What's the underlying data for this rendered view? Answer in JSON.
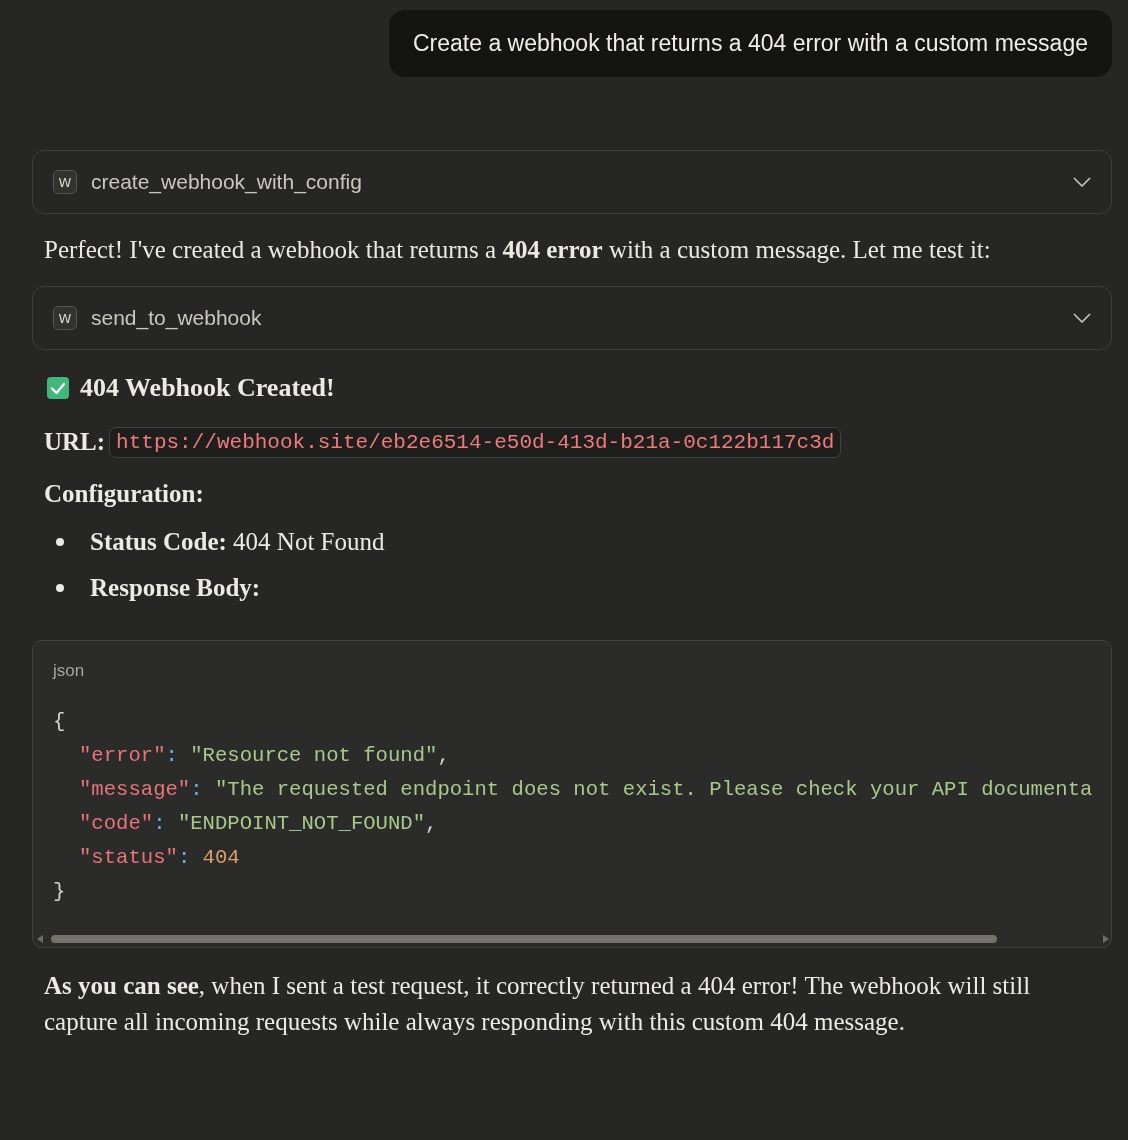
{
  "user_message": "Create a webhook that returns a 404 error with a custom message",
  "blocks": [
    {
      "kind": "tool",
      "badge": "W",
      "name": "create_webhook_with_config",
      "expanded": false
    },
    {
      "kind": "paragraph",
      "text": "Perfect! I've created a webhook that returns a **404 error** with a custom message. Let me test it:"
    },
    {
      "kind": "tool",
      "badge": "W",
      "name": "send_to_webhook",
      "expanded": false
    },
    {
      "kind": "heading",
      "text": "404 Webhook Created!"
    },
    {
      "kind": "url",
      "label": "URL:",
      "value": "https://webhook.site/eb2e6514-e50d-413d-b21a-0c122b117c3d"
    },
    {
      "kind": "label",
      "text": "Configuration:"
    },
    {
      "kind": "list",
      "items": [
        "**Status Code:** 404 Not Found",
        "**Response Body:**"
      ]
    },
    {
      "kind": "code",
      "language": "json",
      "open": "{",
      "close": "}",
      "children": [
        [
          {
            "kind": "key",
            "text": "\"error\""
          },
          {
            "kind": "colon",
            "text": ": "
          },
          {
            "kind": "string",
            "text": "\"Resource not found\""
          },
          {
            "kind": "comma",
            "text": ","
          }
        ],
        [
          {
            "kind": "key",
            "text": "\"message\""
          },
          {
            "kind": "colon",
            "text": ": "
          },
          {
            "kind": "string",
            "text": "\"The requested endpoint does not exist. Please check your API documenta"
          }
        ],
        [
          {
            "kind": "key",
            "text": "\"code\""
          },
          {
            "kind": "colon",
            "text": ": "
          },
          {
            "kind": "string",
            "text": "\"ENDPOINT_NOT_FOUND\""
          },
          {
            "kind": "comma",
            "text": ","
          }
        ],
        [
          {
            "kind": "key",
            "text": "\"status\""
          },
          {
            "kind": "colon",
            "text": ": "
          },
          {
            "kind": "number",
            "text": "404"
          }
        ]
      ]
    },
    {
      "kind": "paragraph",
      "text": "**As you can see**, when I sent a test request, it correctly returned a 404 error! The webhook will still capture all incoming requests while always responding with this custom 404 message."
    }
  ]
}
